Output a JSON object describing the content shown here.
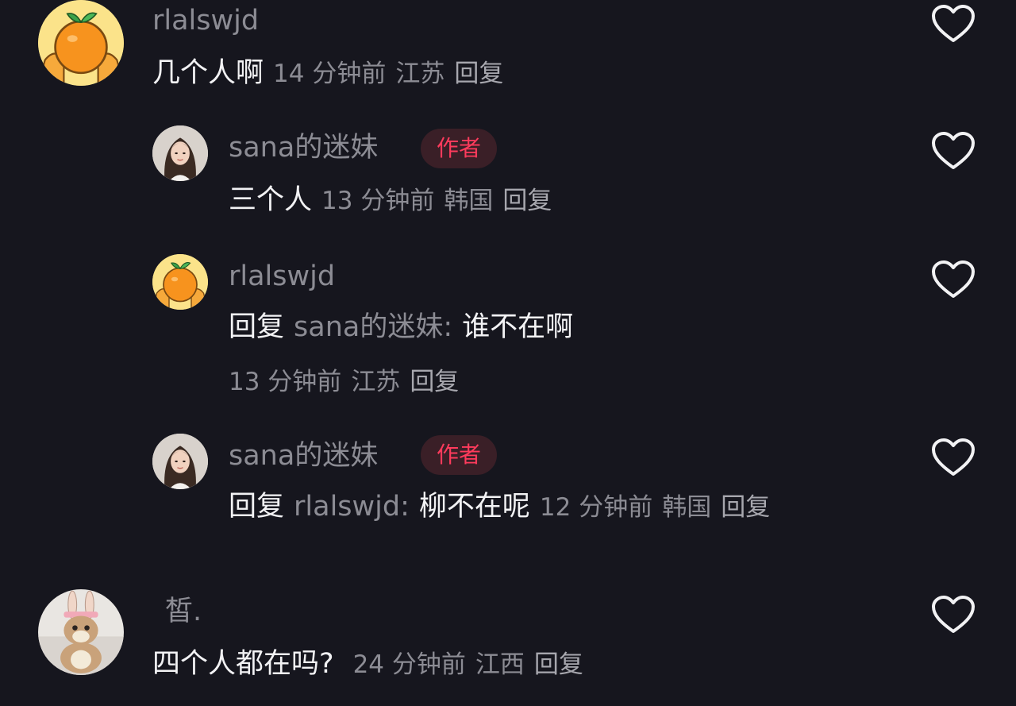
{
  "comments": [
    {
      "username": "rlalswjd",
      "text": "几个人啊",
      "time": "14 分钟前",
      "location": "江苏",
      "reply_label": "回复",
      "avatar": "orange-avatar-icon",
      "replies": [
        {
          "username": "sana的迷妹",
          "badge": "作者",
          "text": "三个人",
          "time": "13 分钟前",
          "location": "韩国",
          "reply_label": "回复",
          "avatar": "girl-photo-avatar"
        },
        {
          "username": "rlalswjd",
          "reply_prefix": "回复",
          "reply_to": "sana的迷妹:",
          "text": "谁不在啊",
          "time": "13 分钟前",
          "location": "江苏",
          "reply_label": "回复",
          "avatar": "orange-avatar-icon"
        },
        {
          "username": "sana的迷妹",
          "badge": "作者",
          "reply_prefix": "回复",
          "reply_to": "rlalswjd:",
          "text": "柳不在呢",
          "time": "12 分钟前",
          "location": "韩国",
          "reply_label": "回复",
          "avatar": "girl-photo-avatar"
        }
      ]
    },
    {
      "username": "皙.",
      "text": "四个人都在吗?",
      "time": "24 分钟前",
      "location": "江西",
      "reply_label": "回复",
      "avatar": "bunny-plush-avatar"
    }
  ],
  "colors": {
    "background": "#16161e",
    "text_primary": "#f2f2f4",
    "text_secondary": "#8c8c94",
    "author_badge_text": "#ff3b5c",
    "author_badge_bg": "#3a1f27"
  },
  "icons": {
    "like": "heart-outline-icon"
  }
}
